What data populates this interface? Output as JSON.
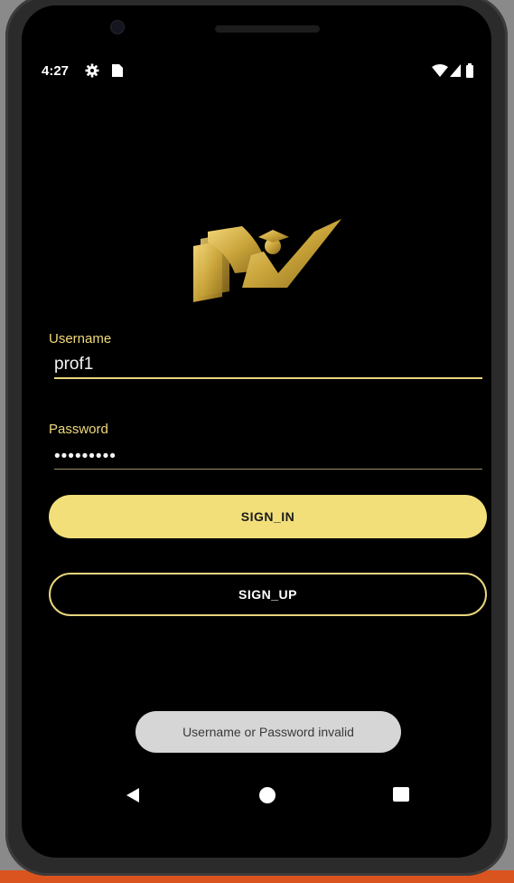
{
  "status_bar": {
    "time": "4:27",
    "icons": [
      "gear-icon",
      "sim-card-icon",
      "wifi-icon",
      "cell-signal-icon",
      "battery-icon"
    ]
  },
  "logo": {
    "icon": "graduation-book-check-logo",
    "color": "#c9a43a"
  },
  "form": {
    "username_label": "Username",
    "username_value": "prof1",
    "password_label": "Password",
    "password_value": "•••••••••"
  },
  "buttons": {
    "sign_in": "SIGN_IN",
    "sign_up": "SIGN_UP"
  },
  "toast": {
    "message": "Username or Password invalid"
  },
  "nav_bar": {
    "icons": [
      "back-icon",
      "home-icon",
      "recents-icon"
    ]
  },
  "colors": {
    "background": "#000000",
    "accent_gold": "#f2df7a",
    "label_gold": "#f0d97a",
    "toast_bg": "#d6d6d6"
  }
}
